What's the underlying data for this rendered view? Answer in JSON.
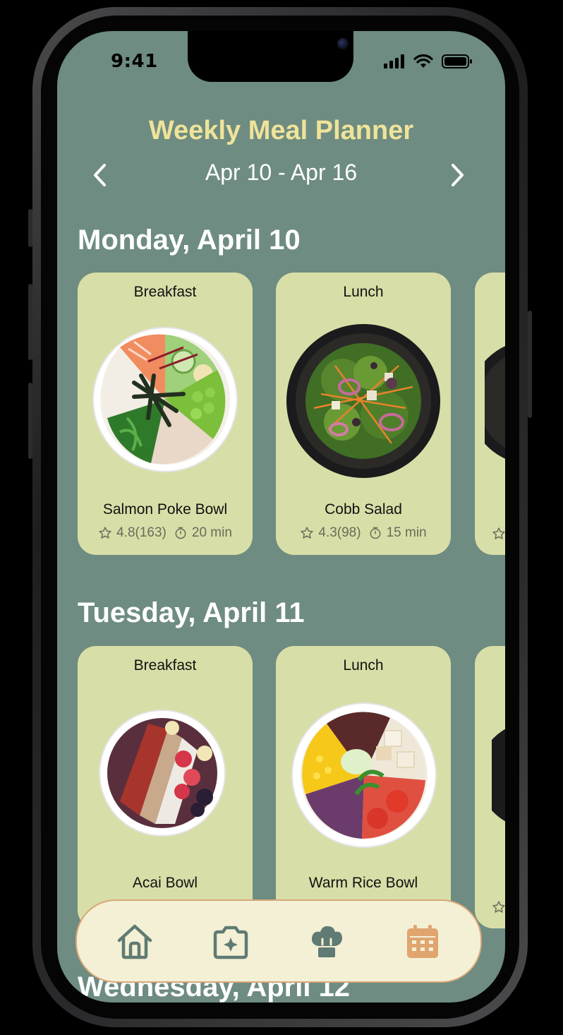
{
  "status_bar": {
    "time": "9:41"
  },
  "header": {
    "title": "Weekly Meal Planner",
    "week_range": "Apr 10 - Apr 16"
  },
  "days": [
    {
      "heading": "Monday, April 10",
      "meals": [
        {
          "type": "Breakfast",
          "name": "Salmon Poke Bowl",
          "rating": "4.8(163)",
          "time": "20 min"
        },
        {
          "type": "Lunch",
          "name": "Cobb Salad",
          "rating": "4.3(98)",
          "time": "15 min"
        }
      ]
    },
    {
      "heading": "Tuesday, April 11",
      "meals": [
        {
          "type": "Breakfast",
          "name": "Acai Bowl"
        },
        {
          "type": "Lunch",
          "name": "Warm Rice Bowl"
        }
      ]
    },
    {
      "heading": "Wednesday, April 12"
    }
  ],
  "bottom_nav": {
    "items": [
      {
        "icon": "home-icon",
        "active": false
      },
      {
        "icon": "camera-icon",
        "active": false
      },
      {
        "icon": "chef-hat-icon",
        "active": false
      },
      {
        "icon": "calendar-icon",
        "active": true
      }
    ]
  },
  "colors": {
    "background": "#6e8c81",
    "title": "#efe39a",
    "card": "#d8dea7",
    "nav_bar": "#f4f0d5",
    "nav_border": "#d8a779",
    "icon_default": "#5f7b73",
    "icon_active": "#e0a56f"
  }
}
